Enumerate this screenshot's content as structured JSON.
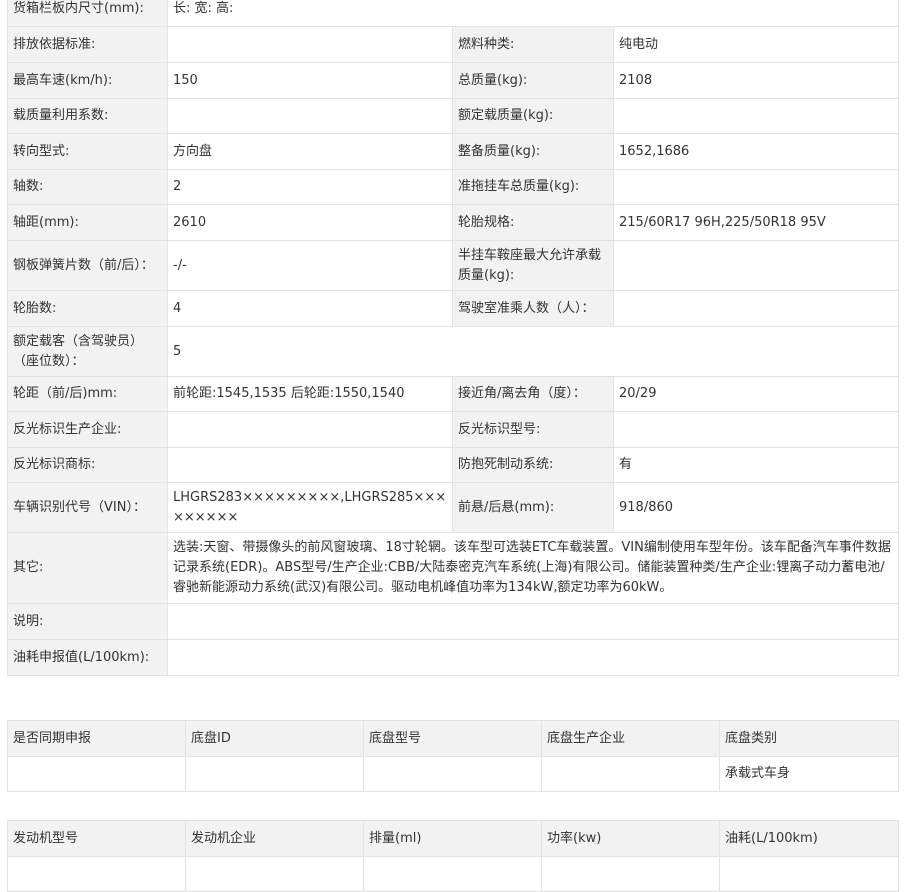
{
  "main_rows": [
    {
      "type": "full",
      "label": "货箱栏板内尺寸(mm):",
      "value": "长:  宽:  高:"
    },
    {
      "type": "pair",
      "l1": "排放依据标准:",
      "v1": "",
      "l2": "燃料种类:",
      "v2": "纯电动"
    },
    {
      "type": "pair",
      "l1": "最高车速(km/h):",
      "v1": "150",
      "l2": "总质量(kg):",
      "v2": "2108"
    },
    {
      "type": "pair",
      "l1": "载质量利用系数:",
      "v1": "",
      "l2": "额定载质量(kg):",
      "v2": ""
    },
    {
      "type": "pair",
      "l1": "转向型式:",
      "v1": "方向盘",
      "l2": "整备质量(kg):",
      "v2": "1652,1686"
    },
    {
      "type": "pair",
      "l1": "轴数:",
      "v1": "2",
      "l2": "准拖挂车总质量(kg):",
      "v2": ""
    },
    {
      "type": "pair",
      "l1": "轴距(mm):",
      "v1": "2610",
      "l2": "轮胎规格:",
      "v2": "215/60R17 96H,225/50R18 95V"
    },
    {
      "type": "pair",
      "l1": "钢板弹簧片数（前/后）：",
      "v1": "-/-",
      "l2": "半挂车鞍座最大允许承载质量(kg):",
      "v2": ""
    },
    {
      "type": "pair",
      "l1": "轮胎数:",
      "v1": "4",
      "l2": "驾驶室准乘人数（人）：",
      "v2": ""
    },
    {
      "type": "full",
      "label": "额定载客（含驾驶员）（座位数）：",
      "value": "5"
    },
    {
      "type": "pair",
      "l1": "轮距（前/后)mm:",
      "v1": "前轮距:1545,1535 后轮距:1550,1540",
      "l2": "接近角/离去角（度）：",
      "v2": "20/29"
    },
    {
      "type": "pair",
      "l1": "反光标识生产企业:",
      "v1": "",
      "l2": "反光标识型号:",
      "v2": ""
    },
    {
      "type": "pair",
      "l1": "反光标识商标:",
      "v1": "",
      "l2": "防抱死制动系统:",
      "v2": "有"
    },
    {
      "type": "pair",
      "l1": "车辆识别代号（VIN）：",
      "v1": "LHGRS283×××××××××,LHGRS285×××××××××",
      "l2": "前悬/后悬(mm):",
      "v2": "918/860"
    },
    {
      "type": "full",
      "label": "其它:",
      "value": "选装:天窗、带摄像头的前风窗玻璃、18寸轮辋。该车型可选装ETC车载装置。VIN编制使用车型年份。该车配备汽车事件数据记录系统(EDR)。ABS型号/生产企业:CBB/大陆泰密克汽车系统(上海)有限公司。储能装置种类/生产企业:锂离子动力蓄电池/睿驰新能源动力系统(武汉)有限公司。驱动电机峰值功率为134kW,额定功率为60kW。"
    },
    {
      "type": "full",
      "label": "说明:",
      "value": ""
    },
    {
      "type": "full",
      "label": "油耗申报值(L/100km):",
      "value": ""
    }
  ],
  "chassis": {
    "headers": [
      "是否同期申报",
      "底盘ID",
      "底盘型号",
      "底盘生产企业",
      "底盘类别"
    ],
    "row": [
      "",
      "",
      "",
      "",
      "承载式车身"
    ]
  },
  "engine": {
    "headers": [
      "发动机型号",
      "发动机企业",
      "排量(ml)",
      "功率(kw)",
      "油耗(L/100km)"
    ]
  }
}
